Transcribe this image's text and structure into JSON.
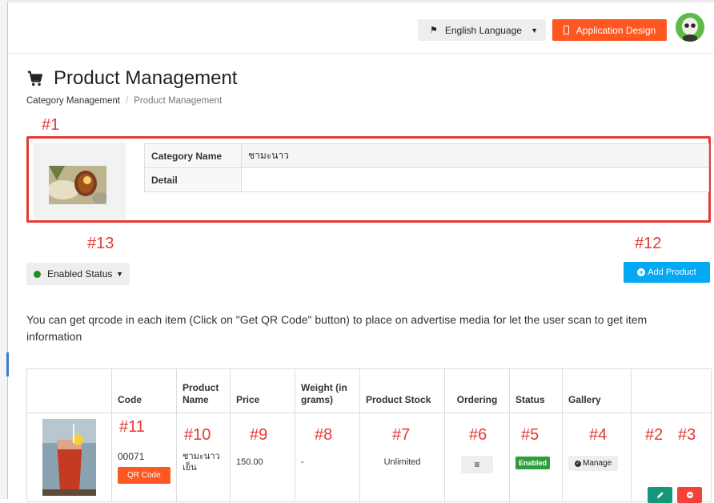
{
  "topbar": {
    "language_label": "English Language",
    "design_label": "Application Design"
  },
  "page": {
    "title": "Product Management",
    "breadcrumb": [
      "Category Management",
      "Product Management"
    ]
  },
  "callouts": {
    "c1": "#1",
    "c2": "#2",
    "c3": "#3",
    "c4": "#4",
    "c5": "#5",
    "c6": "#6",
    "c7": "#7",
    "c8": "#8",
    "c9": "#9",
    "c10": "#10",
    "c11": "#11",
    "c12": "#12",
    "c13": "#13"
  },
  "category": {
    "rows": [
      {
        "label": "Category Name",
        "value": "ชามะนาว"
      },
      {
        "label": "Detail",
        "value": ""
      }
    ]
  },
  "filter": {
    "status_label": "Enabled Status"
  },
  "actions": {
    "add_label": "Add Product"
  },
  "info_text": "You can get qrcode in each item (Click on \"Get QR Code\" button) to place on advertise media for let the user scan to get item information",
  "table": {
    "headers": {
      "image": "",
      "code": "Code",
      "name": "Product Name",
      "price": "Price",
      "weight": "Weight (in grams)",
      "stock": "Product Stock",
      "ordering": "Ordering",
      "status": "Status",
      "gallery": "Gallery",
      "actions": ""
    },
    "rows": [
      {
        "code": "00071",
        "qr_label": "QR Code",
        "name": "ชามะนาวเย็น",
        "price": "150.00",
        "weight": "-",
        "stock": "Unlimited",
        "status": "Enabled",
        "gallery_label": "Manage"
      }
    ]
  },
  "colors": {
    "accent_orange": "#ff5722",
    "accent_blue": "#03a9f4",
    "callout_red": "#e53935",
    "enabled_green": "#2e9e3a",
    "edit_teal": "#17967a",
    "delete_red": "#f44336"
  },
  "icons": {
    "title": "shopping-cart-icon",
    "language": "flag-icon",
    "design": "device-icon",
    "ordering": "reorder-icon",
    "gallery": "check-circle-icon",
    "edit": "pencil-icon",
    "delete": "delete-icon"
  }
}
